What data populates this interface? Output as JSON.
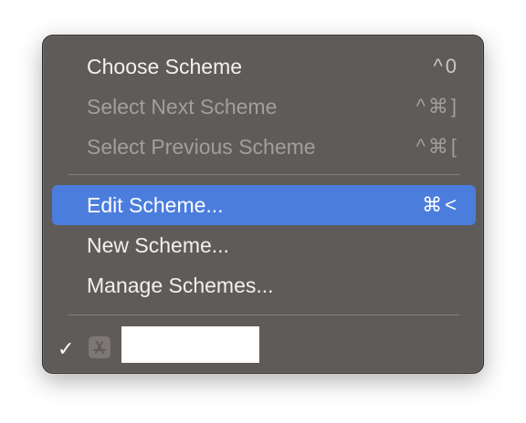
{
  "menu": {
    "items": [
      {
        "label": "Choose Scheme",
        "shortcut": "^0",
        "state": "enabled"
      },
      {
        "label": "Select Next Scheme",
        "shortcut": "^⌘]",
        "state": "disabled"
      },
      {
        "label": "Select Previous Scheme",
        "shortcut": "^⌘[",
        "state": "disabled"
      },
      {
        "label": "Edit Scheme...",
        "shortcut": "⌘<",
        "state": "highlighted"
      },
      {
        "label": "New Scheme...",
        "shortcut": "",
        "state": "enabled"
      },
      {
        "label": "Manage Schemes...",
        "shortcut": "",
        "state": "enabled"
      }
    ],
    "current_scheme": {
      "checkmark": "✓",
      "icon": "app-store-icon",
      "name": ""
    }
  },
  "colors": {
    "menu_background": "#5f5b59",
    "highlight": "#4b7ddd",
    "text": "#f3f1f0",
    "disabled_text": "#a29e9c"
  }
}
